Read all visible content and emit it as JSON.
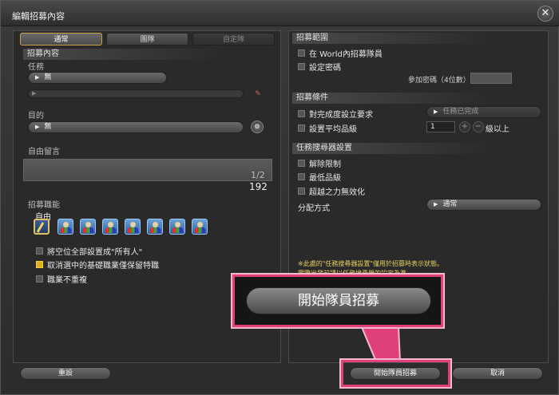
{
  "window": {
    "title": "編輯招募內容"
  },
  "tabs": [
    {
      "label": "通常",
      "state": "active"
    },
    {
      "label": "團隊",
      "state": "normal"
    },
    {
      "label": "自定隊",
      "state": "disabled"
    }
  ],
  "left": {
    "section_title": "招募內容",
    "task_label": "任務",
    "task_value": "無",
    "purpose_label": "目的",
    "purpose_value": "無",
    "comment_label": "自由留言",
    "comment_value": "",
    "comment_page": "1/2",
    "comment_remaining": "192",
    "job_label": "招募職能",
    "job_selected_label": "自由",
    "checkboxes": [
      {
        "label": "將空位全部設置成\"所有人\"",
        "checked": false
      },
      {
        "label": "取消選中的基礎職業僅保留特職",
        "checked": true
      },
      {
        "label": "職業不重複",
        "checked": false
      }
    ]
  },
  "right": {
    "range_title": "招募範圍",
    "range_options": [
      {
        "label": "在 World內招募隊員",
        "checked": false
      },
      {
        "label": "設定密碼",
        "checked": false
      }
    ],
    "password_label": "參加密碼（4位數）",
    "password_value": "",
    "cond_title": "招募條件",
    "cond_options": [
      {
        "label": "對完成度設立要求",
        "checked": false
      },
      {
        "label": "設置平均品級",
        "checked": false
      }
    ],
    "completion_value": "任務已完成",
    "avg_level_value": "1",
    "avg_level_suffix": "級以上",
    "finder_title": "任務搜尋器設置",
    "finder_options": [
      {
        "label": "解除限制",
        "checked": false
      },
      {
        "label": "最低品級",
        "checked": false
      },
      {
        "label": "超越之力無效化",
        "checked": false
      }
    ],
    "distribution_label": "分配方式",
    "distribution_value": "通常",
    "notice_line1": "※此處的\"任務搜尋器設置\"僅用於招募時表示狀態。",
    "notice_line2": "實際出發前請以任務搜尋器的設定為準。"
  },
  "footer": {
    "reset_label": "重設",
    "start_label": "開始隊員招募",
    "cancel_label": "取消"
  },
  "callout": {
    "zoom_label": "開始隊員招募"
  },
  "colors": {
    "highlight": "#e0407a",
    "accent_gold": "#c9a24a",
    "notice": "#e6d060"
  }
}
